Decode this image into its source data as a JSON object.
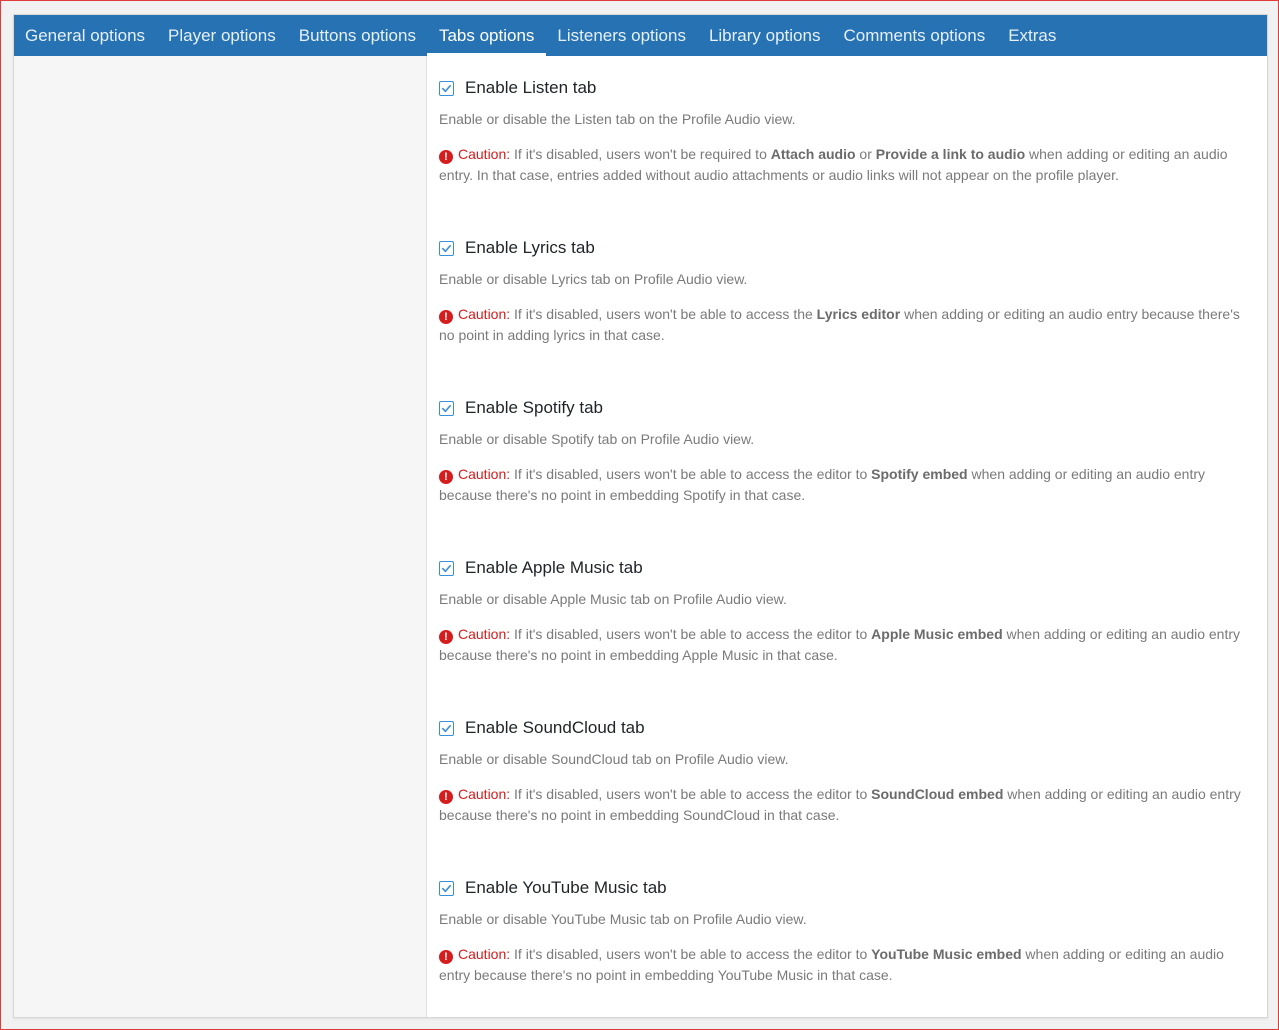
{
  "tabs": [
    {
      "label": "General options"
    },
    {
      "label": "Player options"
    },
    {
      "label": "Buttons options"
    },
    {
      "label": "Tabs options"
    },
    {
      "label": "Listeners options"
    },
    {
      "label": "Library options"
    },
    {
      "label": "Comments options"
    },
    {
      "label": "Extras"
    }
  ],
  "active_tab": "Tabs options",
  "caution_label": "Caution:",
  "options": [
    {
      "title": "Enable Listen tab",
      "checked": true,
      "description": "Enable or disable the Listen tab on the Profile Audio view.",
      "caution_a": "If it's disabled, users won't be required to ",
      "caution_b": "Attach audio",
      "caution_c": " or ",
      "caution_d": "Provide a link to audio",
      "caution_e": " when adding or editing an audio entry. In that case, entries added without audio attachments or audio links will not appear on the profile player."
    },
    {
      "title": "Enable Lyrics tab",
      "checked": true,
      "description": "Enable or disable Lyrics tab on Profile Audio view.",
      "caution_a": "If it's disabled, users won't be able to access the ",
      "caution_b": "Lyrics editor",
      "caution_c": " when adding or editing an audio entry because there's no point in adding lyrics in that case."
    },
    {
      "title": "Enable Spotify tab",
      "checked": true,
      "description": "Enable or disable Spotify tab on Profile Audio view.",
      "caution_a": "If it's disabled, users won't be able to access the editor to ",
      "caution_b": "Spotify embed",
      "caution_c": " when adding or editing an audio entry because there's no point in embedding Spotify in that case."
    },
    {
      "title": "Enable Apple Music tab",
      "checked": true,
      "description": "Enable or disable Apple Music tab on Profile Audio view.",
      "caution_a": "If it's disabled, users won't be able to access the editor to ",
      "caution_b": "Apple Music embed",
      "caution_c": " when adding or editing an audio entry because there's no point in embedding Apple Music in that case."
    },
    {
      "title": "Enable SoundCloud tab",
      "checked": true,
      "description": "Enable or disable SoundCloud tab on Profile Audio view.",
      "caution_a": "If it's disabled, users won't be able to access the editor to ",
      "caution_b": "SoundCloud embed",
      "caution_c": " when adding or editing an audio entry because there's no point in embedding SoundCloud in that case."
    },
    {
      "title": "Enable YouTube Music tab",
      "checked": true,
      "description": "Enable or disable YouTube Music tab on Profile Audio view.",
      "caution_a": "If it's disabled, users won't be able to access the editor to ",
      "caution_b": "YouTube Music embed",
      "caution_c": " when adding or editing an audio entry because there's no point in embedding YouTube Music in that case."
    }
  ],
  "colors": {
    "tabbar": "#2672b3",
    "checkbox": "#3a8ed6",
    "caution": "#d51d1d"
  },
  "icons": {
    "checkbox": "checkmark-icon",
    "caution": "exclamation-circle-icon"
  }
}
